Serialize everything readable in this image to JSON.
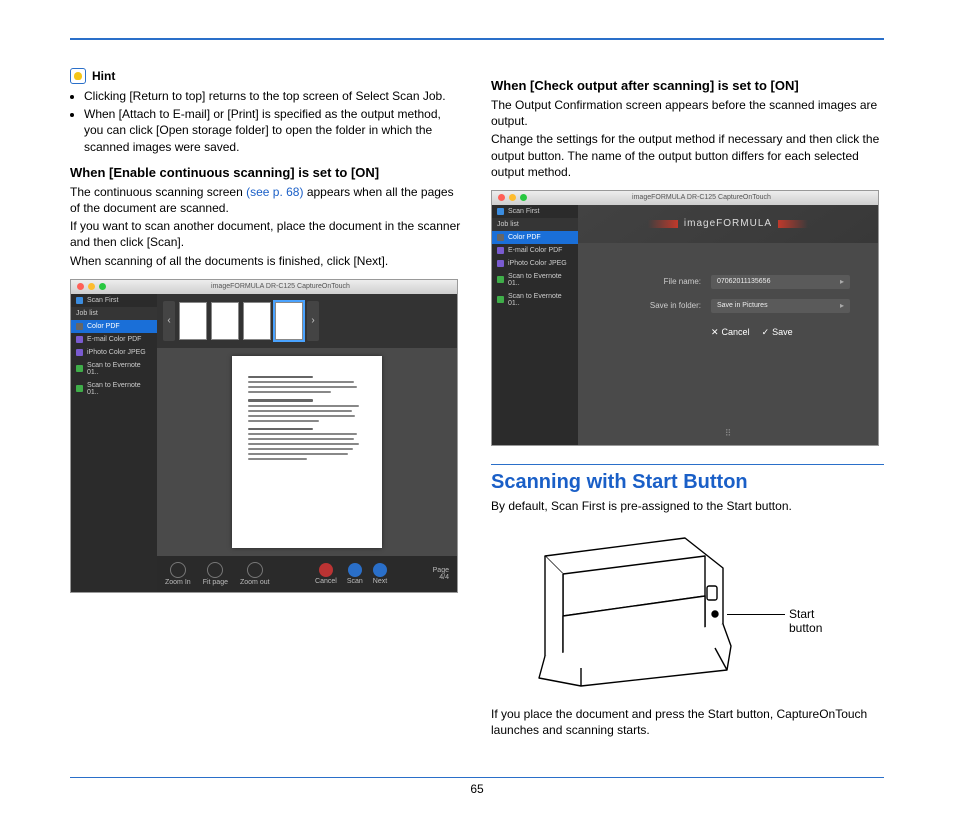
{
  "pageNumber": "65",
  "hint": {
    "label": "Hint",
    "items": [
      "Clicking [Return to top] returns to the top screen of Select Scan Job.",
      "When [Attach to E-mail] or [Print] is specified as the output method, you can click [Open storage folder] to open the folder in which the scanned images were saved."
    ]
  },
  "section1": {
    "heading": "When [Enable continuous scanning] is set to [ON]",
    "p1a": "The continuous scanning screen ",
    "p1_link": "(see p. 68)",
    "p1b": " appears when all the pages of the document are scanned.",
    "p2": "If you want to scan another document, place the document in the scanner and then click [Scan].",
    "p3": "When scanning of all the documents is finished, click [Next]."
  },
  "section2": {
    "heading": "When [Check output after scanning] is set to [ON]",
    "p1": "The Output Confirmation screen appears before the scanned images are output.",
    "p2": "Change the settings for the output method if necessary and then click the output button. The name of the output button differs for each selected output method."
  },
  "section3": {
    "heading": "Scanning with Start Button",
    "p1": "By default, Scan First is pre-assigned to the Start button.",
    "callout": "Start button",
    "p2": "If you place the document and press the Start button, CaptureOnTouch launches and scanning starts."
  },
  "screenshot": {
    "windowTitle": "imageFORMULA DR-C125 CaptureOnTouch",
    "brand": "imageFORMULA",
    "sidebar": {
      "scanFirst": "Scan First",
      "jobList": "Job list",
      "items": [
        "Color PDF",
        "E-mail Color PDF",
        "iPhoto Color JPEG",
        "Scan to Evernote 01..",
        "Scan to Evernote 01.."
      ]
    },
    "bottombar": {
      "zoomIn": "Zoom In",
      "fitPage": "Fit page",
      "zoomOut": "Zoom out",
      "cancel": "Cancel",
      "scan": "Scan",
      "next": "Next",
      "pageLabel": "Page",
      "pageValue": "4/4"
    },
    "form": {
      "fileNameLabel": "File name:",
      "fileNameValue": "07062011135656",
      "saveLabel": "Save in folder:",
      "saveValue": "Save in Pictures",
      "cancel": "Cancel",
      "save": "Save"
    }
  }
}
